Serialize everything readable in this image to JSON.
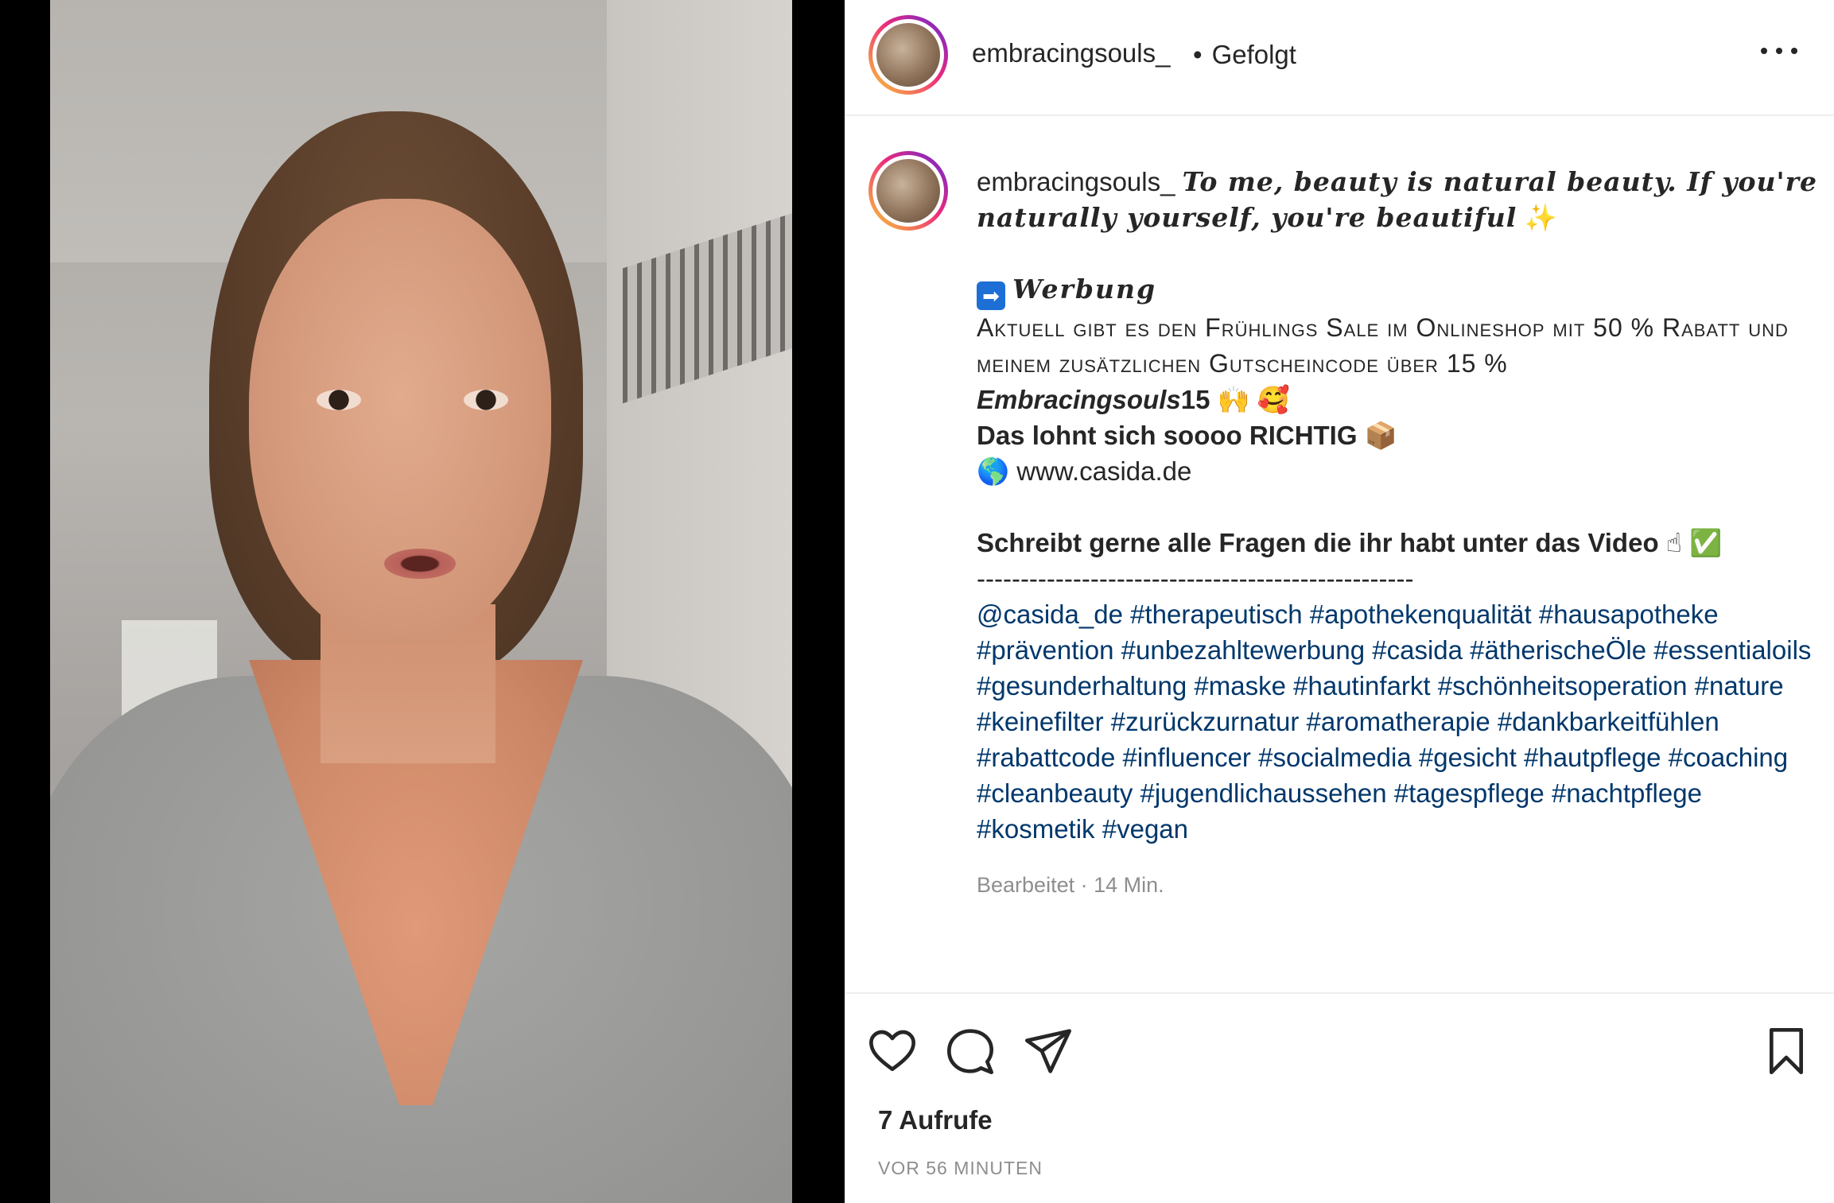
{
  "header": {
    "username": "embracingsouls_",
    "dot": "•",
    "follow_status": "Gefolgt"
  },
  "caption": {
    "username": "embracingsouls_",
    "quote": "To me, beauty is natural beauty. If you're naturally yourself, you're beautiful",
    "quote_emoji": "✨",
    "werbung_arrow": "➡",
    "werbung": "Werbung",
    "line1": "Aktuell gibt es den Frühlings Sale im Onlineshop mit 50 % Rabatt und meinem zusätzlichen Gutscheincode über 15 %",
    "code_italic": "Embracingsouls",
    "code_num": "15",
    "code_emojis": "🙌 🥰",
    "lohnt": "Das lohnt sich soooo RICHTIG",
    "lohnt_emoji": "📦",
    "globe": "🌎",
    "website": "www.casida.de",
    "question": "Schreibt gerne alle Fragen die ihr habt unter das Video",
    "question_emojis": "☝ ✅",
    "dashes": "--------------------------------------------------",
    "tags": [
      "@casida_de",
      "#therapeutisch",
      "#apothekenqualität",
      "#hausapotheke",
      "#prävention",
      "#unbezahltewerbung",
      "#casida",
      "#ätherischeÖle",
      "#essentialoils",
      "#gesunderhaltung",
      "#maske",
      "#hautinfarkt",
      "#schönheitsoperation",
      "#nature",
      "#keinefilter",
      "#zurückzurnatur",
      "#aromatherapie",
      "#dankbarkeitfühlen",
      "#rabattcode",
      "#influencer",
      "#socialmedia",
      "#gesicht",
      "#hautpflege",
      "#coaching",
      "#cleanbeauty",
      "#jugendlichaussehen",
      "#tagespflege",
      "#nachtpflege",
      "#kosmetik",
      "#vegan"
    ],
    "edited": "Bearbeitet · 14 Min."
  },
  "footer": {
    "views": "7 Aufrufe",
    "time": "VOR 56 MINUTEN"
  },
  "icons": {
    "like": "heart-icon",
    "comment": "comment-icon",
    "share": "send-icon",
    "save": "bookmark-icon",
    "more": "more-icon"
  },
  "colors": {
    "hashtag": "#00376b",
    "muted": "#8e8e8e",
    "text": "#262626"
  }
}
